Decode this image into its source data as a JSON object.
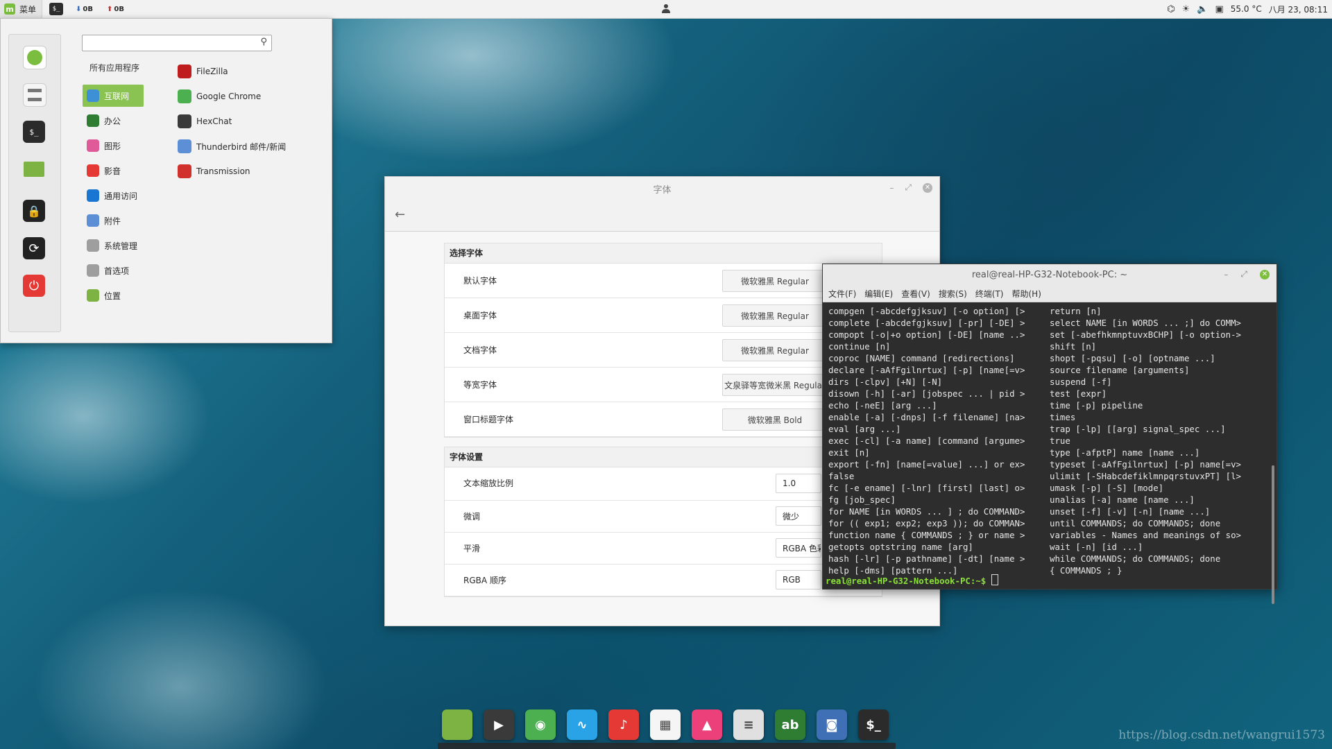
{
  "topbar": {
    "menu_label": "菜单",
    "terminal_glyph": "$_",
    "net_down": "0B",
    "net_up": "0B",
    "temperature": "55.0 °C",
    "datetime": "八月 23, 08:11"
  },
  "startmenu": {
    "search_placeholder": "",
    "all_apps": "所有应用程序",
    "categories": [
      {
        "label": "互联网",
        "icon": "cloud-icon",
        "color": "#3d8fd6"
      },
      {
        "label": "办公",
        "icon": "office-icon",
        "color": "#2e7d32"
      },
      {
        "label": "图形",
        "icon": "graphics-icon",
        "color": "#e05a9a"
      },
      {
        "label": "影音",
        "icon": "media-icon",
        "color": "#e53935"
      },
      {
        "label": "通用访问",
        "icon": "accessibility-icon",
        "color": "#1976d2"
      },
      {
        "label": "附件",
        "icon": "accessories-icon",
        "color": "#5d8fd6"
      },
      {
        "label": "系统管理",
        "icon": "system-icon",
        "color": "#9e9e9e"
      },
      {
        "label": "首选项",
        "icon": "preferences-icon",
        "color": "#9e9e9e"
      },
      {
        "label": "位置",
        "icon": "folder-icon",
        "color": "#7cb342"
      }
    ],
    "apps": [
      {
        "label": "FileZilla",
        "icon": "filezilla-icon",
        "color": "#bf1d1d"
      },
      {
        "label": "Google Chrome",
        "icon": "chrome-icon",
        "color": "#4caf50"
      },
      {
        "label": "HexChat",
        "icon": "hexchat-icon",
        "color": "#3a3a3a"
      },
      {
        "label": "Thunderbird 邮件/新闻",
        "icon": "thunderbird-icon",
        "color": "#5c8fd6"
      },
      {
        "label": "Transmission",
        "icon": "transmission-icon",
        "color": "#d0312d"
      }
    ]
  },
  "fontwin": {
    "title": "字体",
    "section1": "选择字体",
    "rows1": [
      {
        "label": "默认字体",
        "value": "微软雅黑 Regular"
      },
      {
        "label": "桌面字体",
        "value": "微软雅黑 Regular"
      },
      {
        "label": "文档字体",
        "value": "微软雅黑 Regular"
      },
      {
        "label": "等宽字体",
        "value": "文泉驿等宽微米黑 Regular"
      },
      {
        "label": "窗口标题字体",
        "value": "微软雅黑 Bold"
      }
    ],
    "section2": "字体设置",
    "rows2": [
      {
        "label": "文本缩放比例",
        "value": "1.0"
      },
      {
        "label": "微调",
        "value": "微少"
      },
      {
        "label": "平滑",
        "value": "RGBA 色彩"
      },
      {
        "label": "RGBA 顺序",
        "value": "RGB"
      }
    ]
  },
  "terminal": {
    "title": "real@real-HP-G32-Notebook-PC: ~",
    "menu": [
      "文件(F)",
      "编辑(E)",
      "查看(V)",
      "搜索(S)",
      "终端(T)",
      "帮助(H)"
    ],
    "col1": "compgen [-abcdefgjksuv] [-o option] [>\ncomplete [-abcdefgjksuv] [-pr] [-DE] >\ncompopt [-o|+o option] [-DE] [name ..>\ncontinue [n]\ncoproc [NAME] command [redirections]\ndeclare [-aAfFgilnrtux] [-p] [name[=v>\ndirs [-clpv] [+N] [-N]\ndisown [-h] [-ar] [jobspec ... | pid >\necho [-neE] [arg ...]\nenable [-a] [-dnps] [-f filename] [na>\neval [arg ...]\nexec [-cl] [-a name] [command [argume>\nexit [n]\nexport [-fn] [name[=value] ...] or ex>\nfalse\nfc [-e ename] [-lnr] [first] [last] o>\nfg [job_spec]\nfor NAME [in WORDS ... ] ; do COMMAND>\nfor (( exp1; exp2; exp3 )); do COMMAN>\nfunction name { COMMANDS ; } or name >\ngetopts optstring name [arg]\nhash [-lr] [-p pathname] [-dt] [name >\nhelp [-dms] [pattern ...]",
    "col2": "return [n]\nselect NAME [in WORDS ... ;] do COMM>\nset [-abefhkmnptuvxBCHP] [-o option->\nshift [n]\nshopt [-pqsu] [-o] [optname ...]\nsource filename [arguments]\nsuspend [-f]\ntest [expr]\ntime [-p] pipeline\ntimes\ntrap [-lp] [[arg] signal_spec ...]\ntrue\ntype [-afptP] name [name ...]\ntypeset [-aAfFgilnrtux] [-p] name[=v>\nulimit [-SHabcdefiklmnpqrstuvxPT] [l>\numask [-p] [-S] [mode]\nunalias [-a] name [name ...]\nunset [-f] [-v] [-n] [name ...]\nuntil COMMANDS; do COMMANDS; done\nvariables - Names and meanings of so>\nwait [-n] [id ...]\nwhile COMMANDS; do COMMANDS; done\n{ COMMANDS ; }",
    "prompt": "real@real-HP-G32-Notebook-PC:~$ "
  },
  "dock": [
    "files-icon",
    "media-player-icon",
    "chrome-icon",
    "system-monitor-icon",
    "netease-music-icon",
    "calendar-icon",
    "image-viewer-icon",
    "settings-icon",
    "dictionary-icon",
    "screenshot-icon",
    "terminal-icon"
  ],
  "watermark": "https://blog.csdn.net/wangrui1573"
}
